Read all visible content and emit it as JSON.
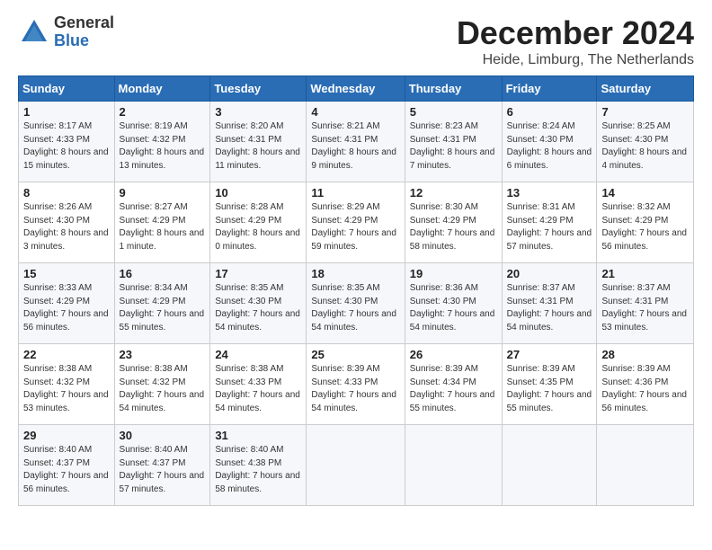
{
  "logo": {
    "general": "General",
    "blue": "Blue"
  },
  "title": "December 2024",
  "subtitle": "Heide, Limburg, The Netherlands",
  "calendar": {
    "headers": [
      "Sunday",
      "Monday",
      "Tuesday",
      "Wednesday",
      "Thursday",
      "Friday",
      "Saturday"
    ],
    "weeks": [
      [
        {
          "day": "1",
          "sunrise": "8:17 AM",
          "sunset": "4:33 PM",
          "daylight": "8 hours and 15 minutes."
        },
        {
          "day": "2",
          "sunrise": "8:19 AM",
          "sunset": "4:32 PM",
          "daylight": "8 hours and 13 minutes."
        },
        {
          "day": "3",
          "sunrise": "8:20 AM",
          "sunset": "4:31 PM",
          "daylight": "8 hours and 11 minutes."
        },
        {
          "day": "4",
          "sunrise": "8:21 AM",
          "sunset": "4:31 PM",
          "daylight": "8 hours and 9 minutes."
        },
        {
          "day": "5",
          "sunrise": "8:23 AM",
          "sunset": "4:31 PM",
          "daylight": "8 hours and 7 minutes."
        },
        {
          "day": "6",
          "sunrise": "8:24 AM",
          "sunset": "4:30 PM",
          "daylight": "8 hours and 6 minutes."
        },
        {
          "day": "7",
          "sunrise": "8:25 AM",
          "sunset": "4:30 PM",
          "daylight": "8 hours and 4 minutes."
        }
      ],
      [
        {
          "day": "8",
          "sunrise": "8:26 AM",
          "sunset": "4:30 PM",
          "daylight": "8 hours and 3 minutes."
        },
        {
          "day": "9",
          "sunrise": "8:27 AM",
          "sunset": "4:29 PM",
          "daylight": "8 hours and 1 minute."
        },
        {
          "day": "10",
          "sunrise": "8:28 AM",
          "sunset": "4:29 PM",
          "daylight": "8 hours and 0 minutes."
        },
        {
          "day": "11",
          "sunrise": "8:29 AM",
          "sunset": "4:29 PM",
          "daylight": "7 hours and 59 minutes."
        },
        {
          "day": "12",
          "sunrise": "8:30 AM",
          "sunset": "4:29 PM",
          "daylight": "7 hours and 58 minutes."
        },
        {
          "day": "13",
          "sunrise": "8:31 AM",
          "sunset": "4:29 PM",
          "daylight": "7 hours and 57 minutes."
        },
        {
          "day": "14",
          "sunrise": "8:32 AM",
          "sunset": "4:29 PM",
          "daylight": "7 hours and 56 minutes."
        }
      ],
      [
        {
          "day": "15",
          "sunrise": "8:33 AM",
          "sunset": "4:29 PM",
          "daylight": "7 hours and 56 minutes."
        },
        {
          "day": "16",
          "sunrise": "8:34 AM",
          "sunset": "4:29 PM",
          "daylight": "7 hours and 55 minutes."
        },
        {
          "day": "17",
          "sunrise": "8:35 AM",
          "sunset": "4:30 PM",
          "daylight": "7 hours and 54 minutes."
        },
        {
          "day": "18",
          "sunrise": "8:35 AM",
          "sunset": "4:30 PM",
          "daylight": "7 hours and 54 minutes."
        },
        {
          "day": "19",
          "sunrise": "8:36 AM",
          "sunset": "4:30 PM",
          "daylight": "7 hours and 54 minutes."
        },
        {
          "day": "20",
          "sunrise": "8:37 AM",
          "sunset": "4:31 PM",
          "daylight": "7 hours and 54 minutes."
        },
        {
          "day": "21",
          "sunrise": "8:37 AM",
          "sunset": "4:31 PM",
          "daylight": "7 hours and 53 minutes."
        }
      ],
      [
        {
          "day": "22",
          "sunrise": "8:38 AM",
          "sunset": "4:32 PM",
          "daylight": "7 hours and 53 minutes."
        },
        {
          "day": "23",
          "sunrise": "8:38 AM",
          "sunset": "4:32 PM",
          "daylight": "7 hours and 54 minutes."
        },
        {
          "day": "24",
          "sunrise": "8:38 AM",
          "sunset": "4:33 PM",
          "daylight": "7 hours and 54 minutes."
        },
        {
          "day": "25",
          "sunrise": "8:39 AM",
          "sunset": "4:33 PM",
          "daylight": "7 hours and 54 minutes."
        },
        {
          "day": "26",
          "sunrise": "8:39 AM",
          "sunset": "4:34 PM",
          "daylight": "7 hours and 55 minutes."
        },
        {
          "day": "27",
          "sunrise": "8:39 AM",
          "sunset": "4:35 PM",
          "daylight": "7 hours and 55 minutes."
        },
        {
          "day": "28",
          "sunrise": "8:39 AM",
          "sunset": "4:36 PM",
          "daylight": "7 hours and 56 minutes."
        }
      ],
      [
        {
          "day": "29",
          "sunrise": "8:40 AM",
          "sunset": "4:37 PM",
          "daylight": "7 hours and 56 minutes."
        },
        {
          "day": "30",
          "sunrise": "8:40 AM",
          "sunset": "4:37 PM",
          "daylight": "7 hours and 57 minutes."
        },
        {
          "day": "31",
          "sunrise": "8:40 AM",
          "sunset": "4:38 PM",
          "daylight": "7 hours and 58 minutes."
        },
        null,
        null,
        null,
        null
      ]
    ]
  }
}
